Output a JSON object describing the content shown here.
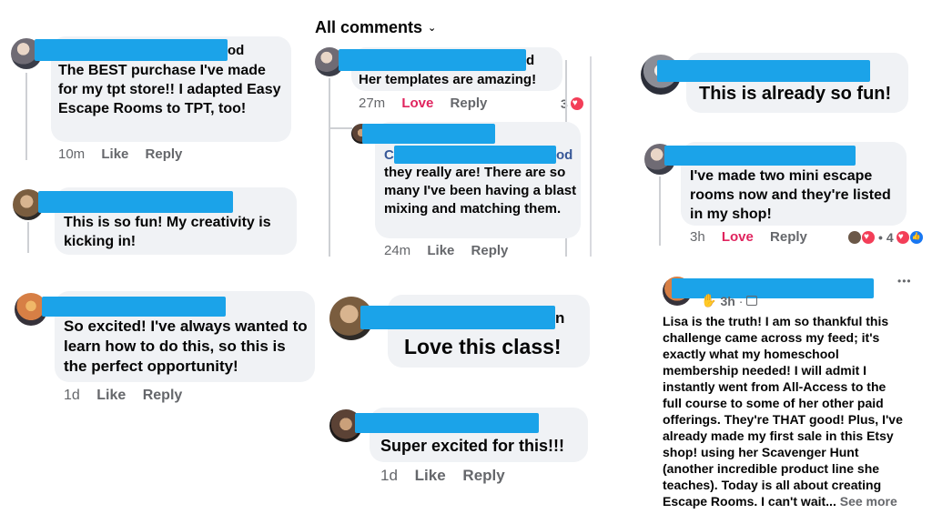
{
  "header": {
    "title": "All comments",
    "chevron": "chevron-down-icon"
  },
  "colors": {
    "redaction": "#1ba3e9",
    "love": "#e0245e",
    "bubble": "#f0f2f5",
    "muted": "#65676b"
  },
  "comments": {
    "c1": {
      "name_tail": "od",
      "text": "The BEST purchase I've made for my tpt store!! I adapted Easy Escape Rooms to TPT, too!",
      "time": "10m",
      "like": "Like",
      "reply": "Reply"
    },
    "c2": {
      "text": "This is so fun!  My creativity is kicking in!"
    },
    "c3": {
      "text": "So excited! I've always wanted to learn how to do this, so this is the perfect opportunity!",
      "time": "1d",
      "like": "Like",
      "reply": "Reply"
    },
    "c4": {
      "name_tail": "d",
      "text": "Her templates are amazing!",
      "time": "27m",
      "love": "Love",
      "reply": "Reply",
      "reactions": "3"
    },
    "c4r": {
      "name_head": "C",
      "name_tail": "od",
      "text": "they really are!  There are so many I've been having a blast mixing and matching them.",
      "time": "24m",
      "like": "Like",
      "reply": "Reply"
    },
    "c5": {
      "name_tail": "n",
      "text": "Love this class!"
    },
    "c6": {
      "text": "Super excited for this!!!",
      "time": "1d",
      "like": "Like",
      "reply": "Reply"
    },
    "c7": {
      "text": "This is already so fun!"
    },
    "c8": {
      "text": "I've made two mini escape rooms now and they're listed in my shop!",
      "time": "3h",
      "love": "Love",
      "reply": "Reply",
      "reactions_sep": "•",
      "reactions": "4"
    },
    "post": {
      "time": "3h",
      "more": "•••",
      "text": "Lisa is the truth! I am so thankful this challenge came across my feed; it's exactly what my homeschool membership needed! I will admit I instantly went from All-Access to the full course to some of her other paid offerings. They're THAT good! Plus, I've already made my first sale in this Etsy shop! using her Scavenger Hunt (another incredible product line she teaches). Today is all about creating Escape Rooms. I can't wait...",
      "see_more": "See more"
    }
  }
}
